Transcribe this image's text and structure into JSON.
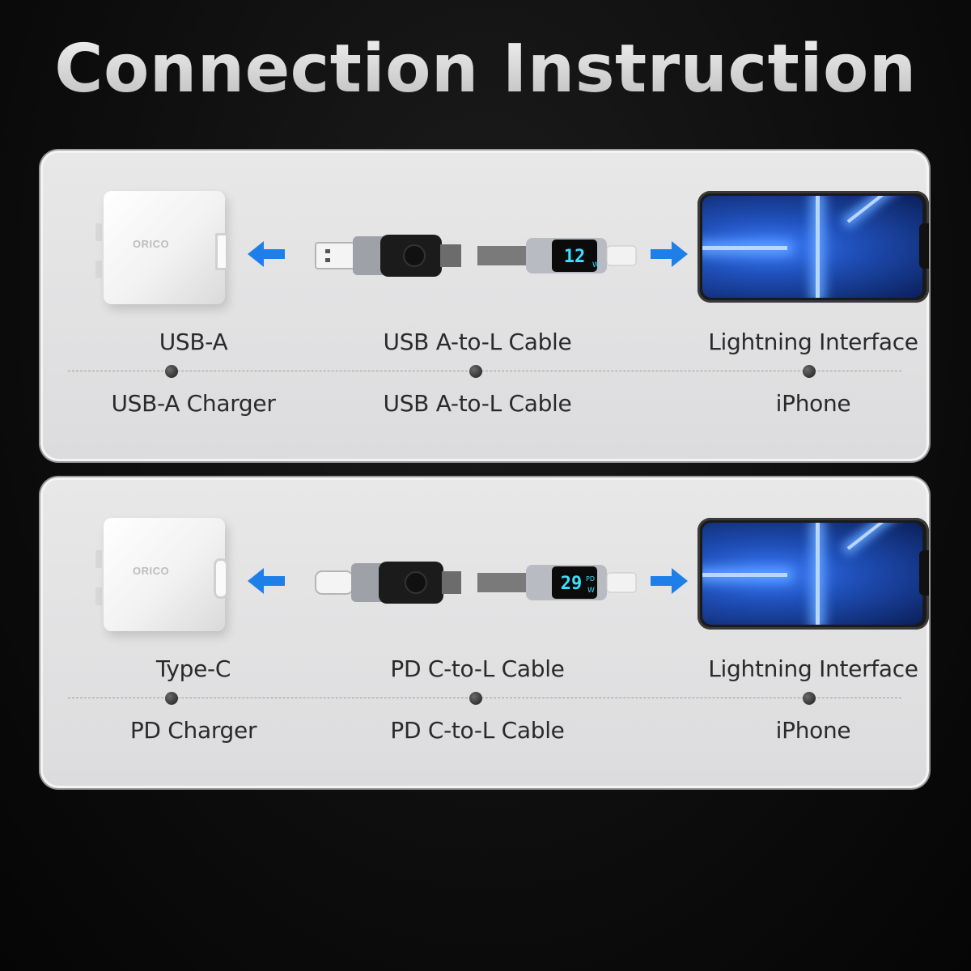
{
  "title": "Connection Instruction",
  "panels": [
    {
      "charger_brand": "ORICO",
      "cable_display": "12 W",
      "top_labels": [
        "USB-A",
        "USB A-to-L Cable",
        "Lightning Interface"
      ],
      "bottom_labels": [
        "USB-A Charger",
        "USB A-to-L Cable",
        "iPhone"
      ]
    },
    {
      "charger_brand": "ORICO",
      "cable_display": "29 PD W",
      "top_labels": [
        "Type-C",
        "PD C-to-L Cable",
        "Lightning Interface"
      ],
      "bottom_labels": [
        "PD Charger",
        "PD C-to-L Cable",
        "iPhone"
      ]
    }
  ],
  "colors": {
    "arrow": "#1e7fe8",
    "lcd": "#3ee0ff",
    "label": "#2a2a2a"
  },
  "icons": [
    "arrow-left-icon",
    "arrow-right-icon"
  ]
}
